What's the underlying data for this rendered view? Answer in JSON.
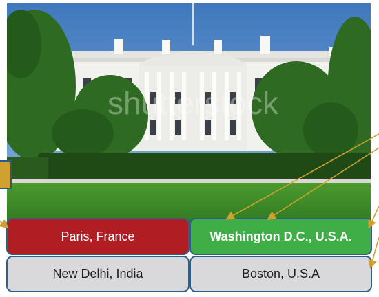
{
  "watermark": "shutterstock",
  "options": [
    {
      "label": "Paris, France",
      "state": "incorrect",
      "color": "#b01e23"
    },
    {
      "label": "Washington D.C., U.S.A.",
      "state": "correct",
      "color": "#3fae47"
    },
    {
      "label": "New Delhi, India",
      "state": "neutral",
      "color": "#d9d9db"
    },
    {
      "label": "Boston, U.S.A",
      "state": "neutral",
      "color": "#d9d9db"
    }
  ],
  "colors": {
    "border": "#2e5f87",
    "arrow": "#d0a030",
    "sky": "#4f86c6",
    "lawn": "#3a8a2a"
  }
}
